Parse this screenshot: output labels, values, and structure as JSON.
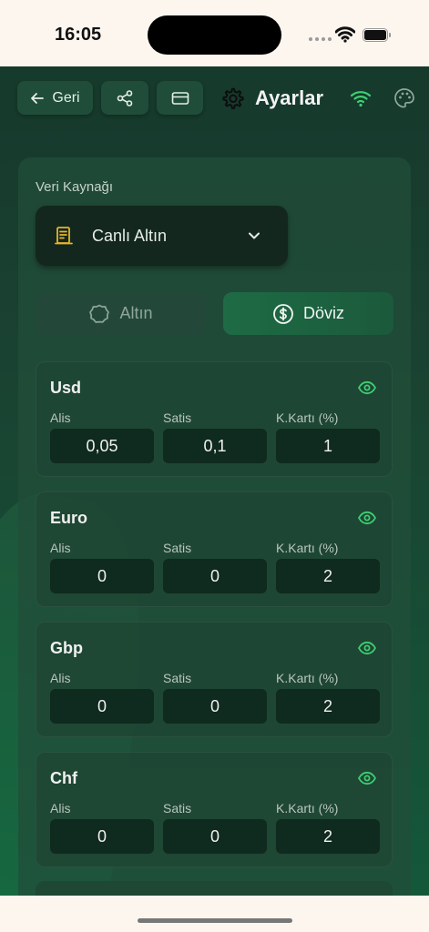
{
  "status_bar": {
    "time": "16:05"
  },
  "header": {
    "back_label": "Geri",
    "title": "Ayarlar"
  },
  "icons": {
    "back": "arrow-left-icon",
    "share": "share-icon",
    "card": "credit-card-icon",
    "settings": "gear-icon",
    "wifi": "wifi-icon",
    "palette": "palette-icon",
    "source": "document-icon",
    "dropdown": "chevron-down-icon",
    "gold": "circle-icon",
    "currency": "dollar-icon",
    "visibility": "eye-icon"
  },
  "colors": {
    "accent_green": "#3ecf72",
    "gold_icon": "#e8b42a",
    "panel_bg": "#224e3a"
  },
  "source": {
    "label": "Veri Kaynağı",
    "selected": "Canlı Altın"
  },
  "tabs": [
    {
      "label": "Altın",
      "active": false
    },
    {
      "label": "Döviz",
      "active": true
    }
  ],
  "columns": {
    "buy": "Alis",
    "sell": "Satis",
    "card": "K.Kartı (%)"
  },
  "currencies": [
    {
      "name": "Usd",
      "buy": "0,05",
      "sell": "0,1",
      "card": "1"
    },
    {
      "name": "Euro",
      "buy": "0",
      "sell": "0",
      "card": "2"
    },
    {
      "name": "Gbp",
      "buy": "0",
      "sell": "0",
      "card": "2"
    },
    {
      "name": "Chf",
      "buy": "0",
      "sell": "0",
      "card": "2"
    }
  ]
}
